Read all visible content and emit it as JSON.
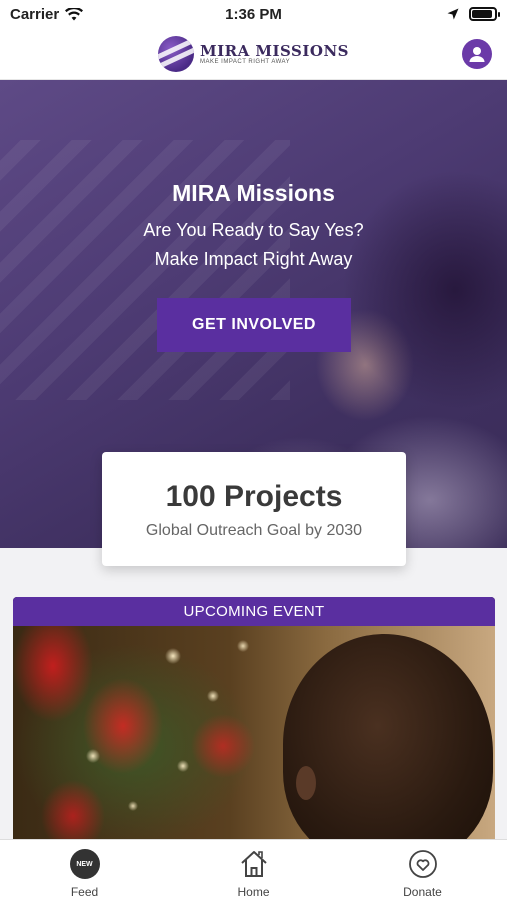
{
  "status_bar": {
    "carrier": "Carrier",
    "time": "1:36 PM",
    "battery_level": 0.9
  },
  "header": {
    "logo_title": "MIRA MISSIONS",
    "logo_tagline": "MAKE IMPACT RIGHT AWAY",
    "profile_icon": "user-icon"
  },
  "hero": {
    "title": "MIRA Missions",
    "subtitle_line1": "Are You Ready to Say Yes?",
    "subtitle_line2": "Make Impact Right Away",
    "cta_label": "GET INVOLVED"
  },
  "stat": {
    "value": "100 Projects",
    "label": "Global Outreach Goal by 2030"
  },
  "event": {
    "banner": "UPCOMING EVENT"
  },
  "tab_bar": {
    "tabs": [
      {
        "label": "Feed",
        "icon": "new-badge-icon",
        "badge": "NEW"
      },
      {
        "label": "Home",
        "icon": "home-icon"
      },
      {
        "label": "Donate",
        "icon": "heart-icon"
      }
    ]
  },
  "colors": {
    "brand_purple": "#5a2fa0",
    "header_bg": "#ffffff"
  }
}
